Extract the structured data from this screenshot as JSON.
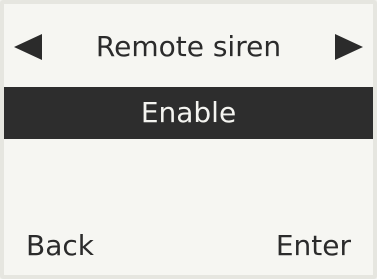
{
  "menu": {
    "title": "Remote siren",
    "prev_icon": "triangle-left-icon",
    "next_icon": "triangle-right-icon",
    "selected_option": "Enable"
  },
  "softkeys": {
    "left_label": "Back",
    "right_label": "Enter"
  },
  "colors": {
    "screen_background": "#f6f6f2",
    "text": "#2b2b2b",
    "highlight_background": "#2d2d2d",
    "highlight_text": "#f4f4f0"
  }
}
